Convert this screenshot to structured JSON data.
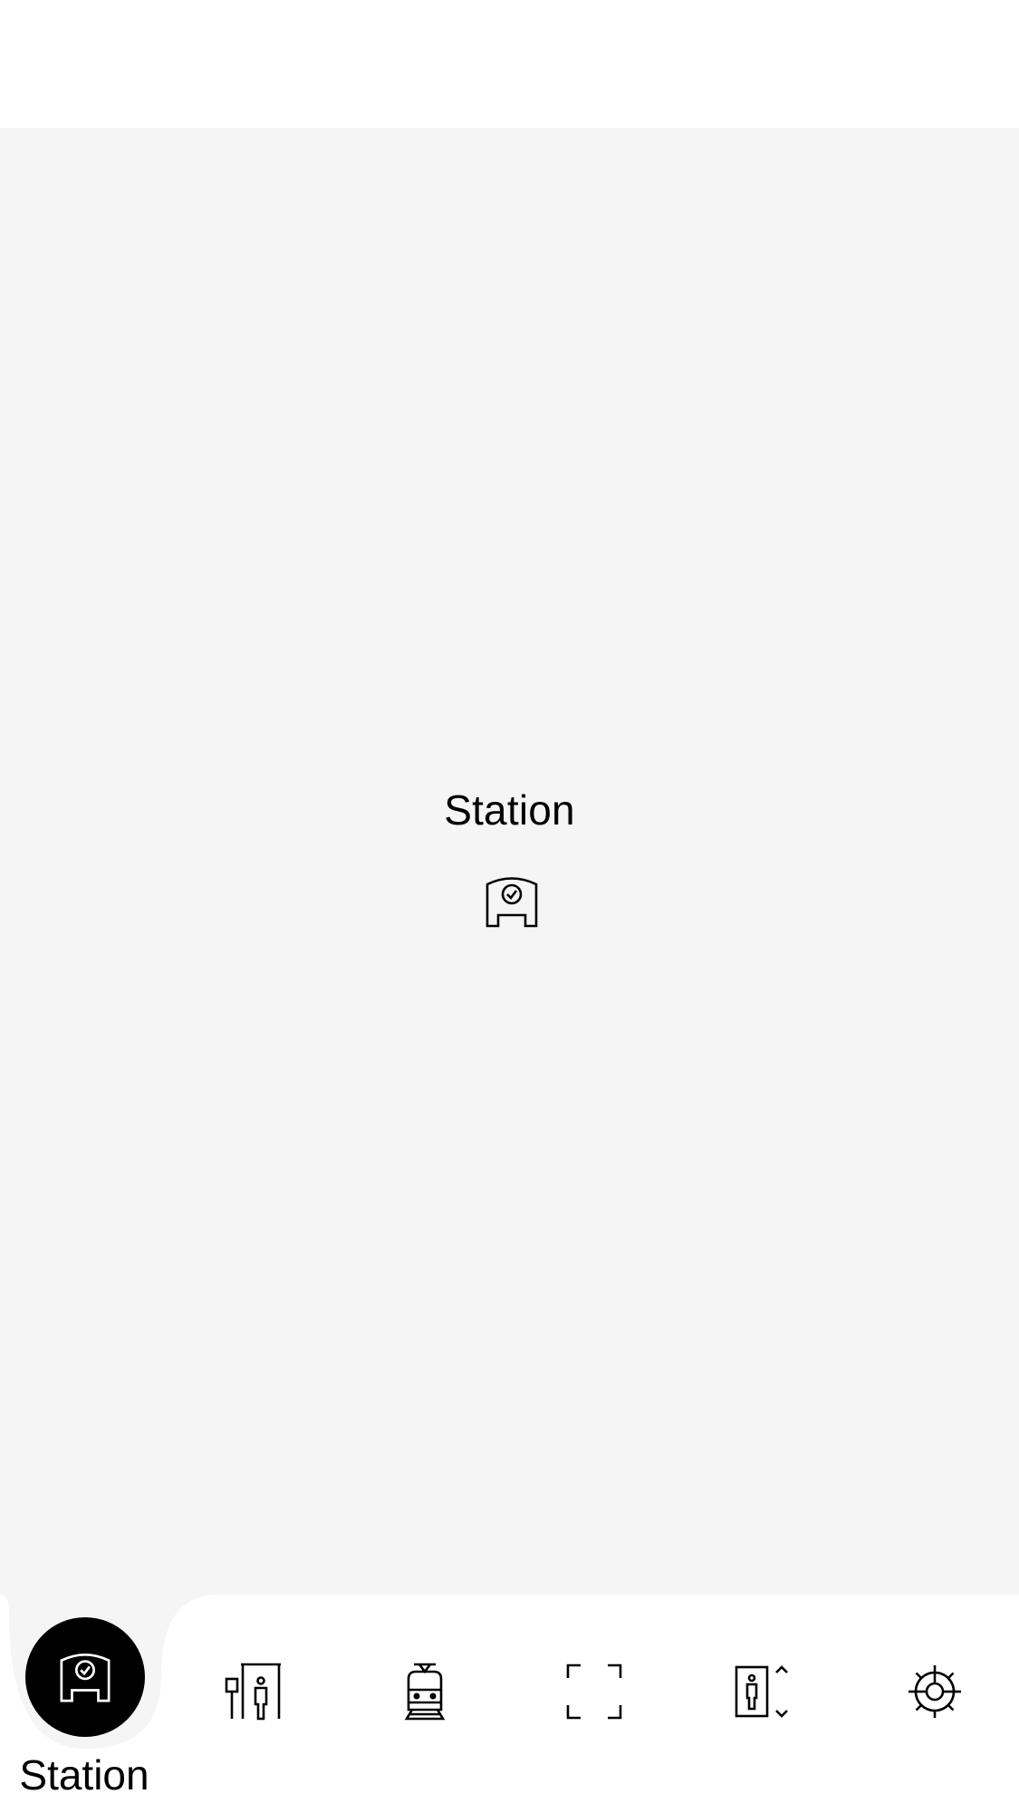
{
  "main": {
    "title": "Station",
    "icon": "station-icon"
  },
  "tabbar": {
    "active_index": 0,
    "active_label": "Station",
    "items": [
      {
        "icon": "station-icon"
      },
      {
        "icon": "platform-person-icon"
      },
      {
        "icon": "train-icon"
      },
      {
        "icon": "scan-frame-icon"
      },
      {
        "icon": "elevator-icon"
      },
      {
        "icon": "settings-wheel-icon"
      }
    ]
  },
  "colors": {
    "background": "#f5f5f5",
    "surface": "#ffffff",
    "accent": "#000000"
  }
}
